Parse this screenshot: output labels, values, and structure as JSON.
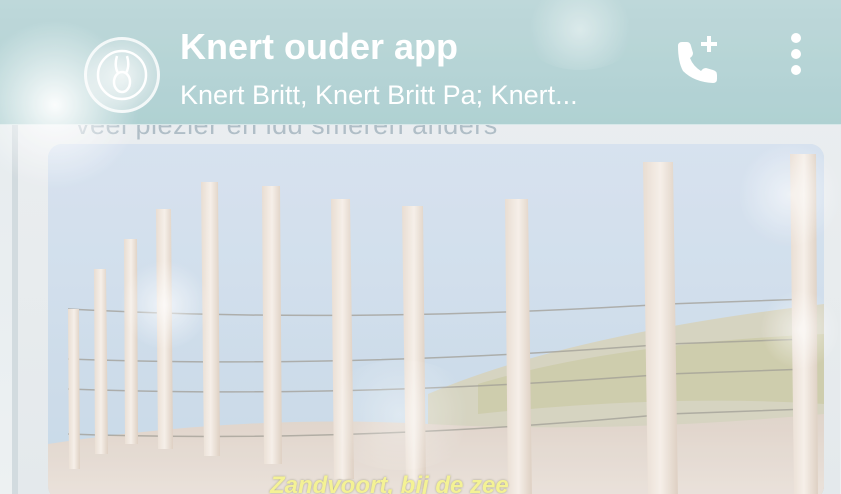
{
  "app_bar": {
    "title": "Knert ouder app",
    "subtitle": "Knert Britt, Knert Britt Pa; Knert...",
    "call_icon": "add-call-icon",
    "menu_icon": "more-vert-icon"
  },
  "conversation": {
    "previous_message_text": "veel plezier en ldd smeren anders",
    "image_caption": "Zandvoort, bij de zee"
  },
  "colors": {
    "app_bar": "#9ec7c9",
    "caption": "#f2f07e",
    "sky": "#c6d7e3"
  }
}
